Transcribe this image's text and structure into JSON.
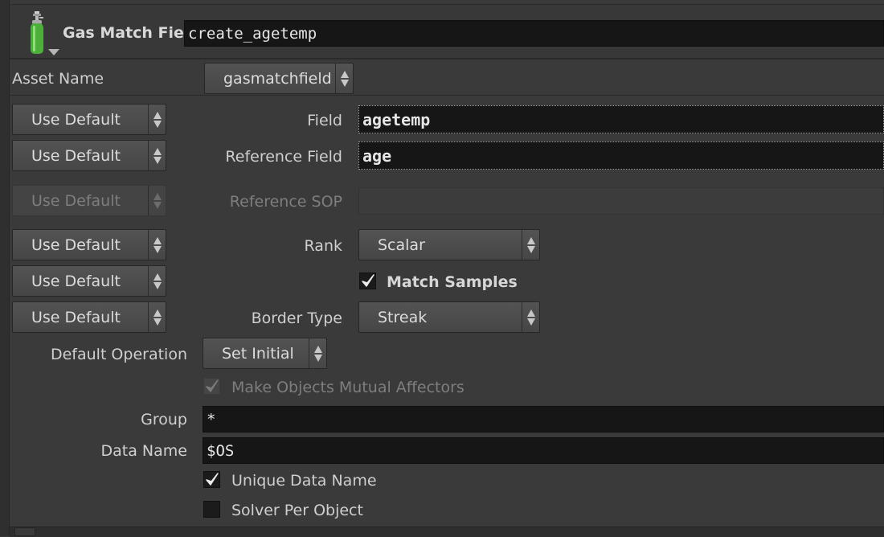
{
  "header": {
    "node_type": "Gas Match Field",
    "node_name": "create_agetemp"
  },
  "asset": {
    "label": "Asset Name",
    "value": "gasmatchfield"
  },
  "params": {
    "field": {
      "mode": "Use Default",
      "label": "Field",
      "value": "agetemp"
    },
    "reference_field": {
      "mode": "Use Default",
      "label": "Reference Field",
      "value": "age"
    },
    "reference_sop": {
      "mode": "Use Default",
      "label": "Reference SOP",
      "value": ""
    },
    "rank": {
      "mode": "Use Default",
      "label": "Rank",
      "value": "Scalar"
    },
    "match_samples": {
      "mode": "Use Default",
      "label": "Match Samples",
      "checked": true
    },
    "border_type": {
      "mode": "Use Default",
      "label": "Border Type",
      "value": "Streak"
    }
  },
  "default_operation": {
    "label": "Default Operation",
    "value": "Set Initial"
  },
  "make_mutual": {
    "label": "Make Objects Mutual Affectors",
    "checked": true,
    "enabled": false
  },
  "group": {
    "label": "Group",
    "value": "*"
  },
  "data_name": {
    "label": "Data Name",
    "value": "$OS"
  },
  "unique_data_name": {
    "label": "Unique Data Name",
    "checked": true
  },
  "solver_per_object": {
    "label": "Solver Per Object",
    "checked": false
  },
  "colors": {
    "background": "#3a3a3a",
    "field_bg": "#161616",
    "tank_green": "#4caf3a"
  },
  "icons": [
    "gas-tank-icon",
    "menu-arrows-icon",
    "checkmark-icon"
  ]
}
